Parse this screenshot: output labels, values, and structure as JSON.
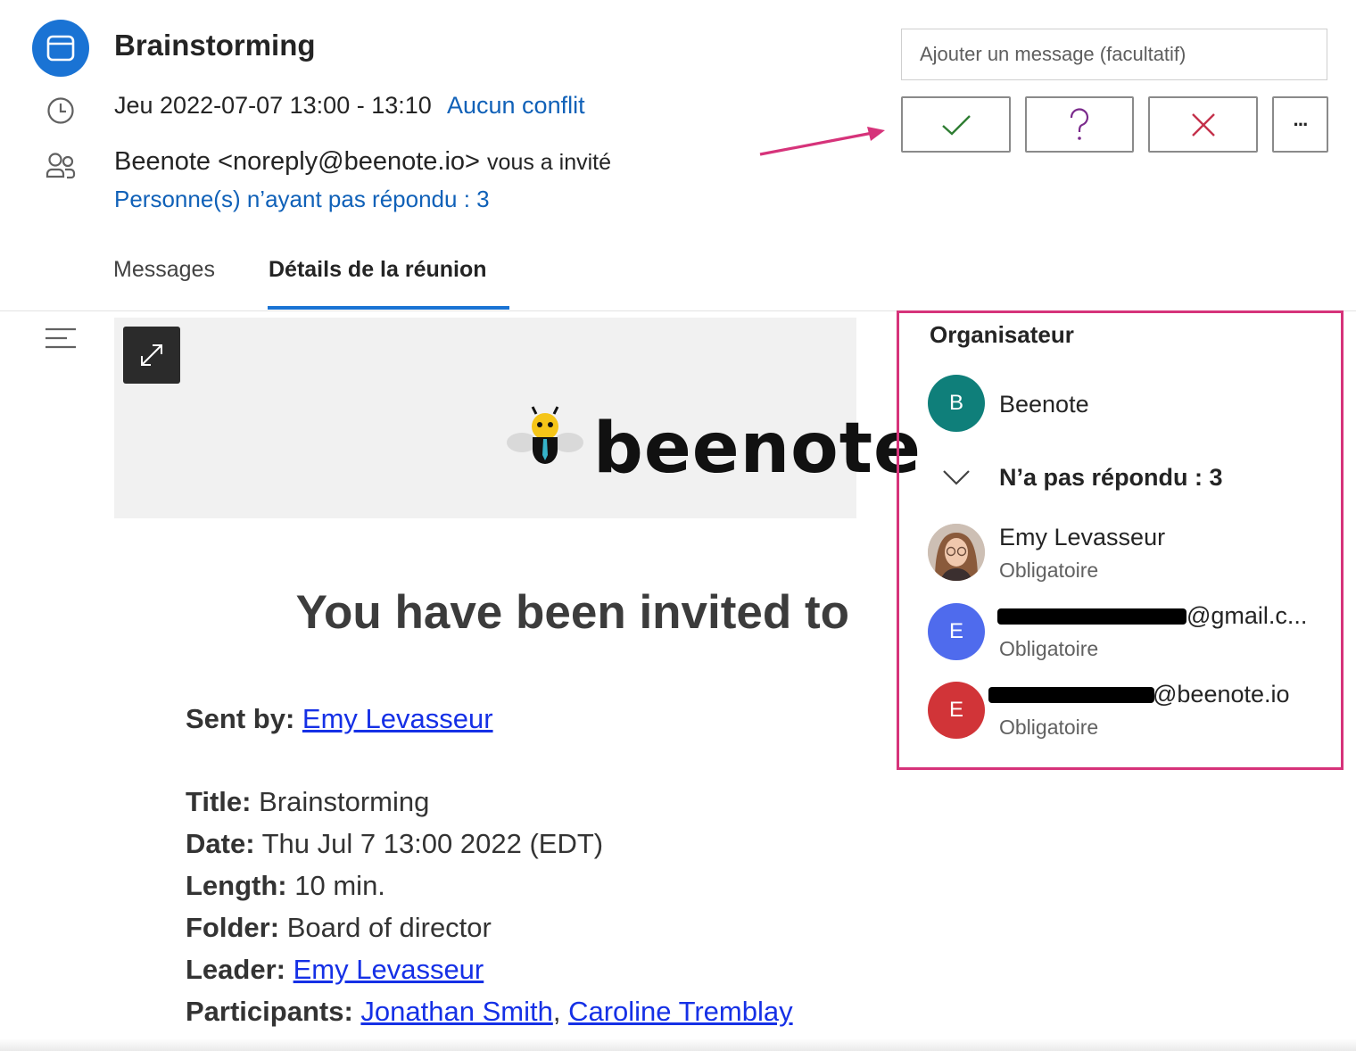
{
  "header": {
    "title": "Brainstorming",
    "date": "Jeu 2022-07-07 13:00 - 13:10",
    "conflict": "Aucun conflit",
    "organizer": "Beenote <noreply@beenote.io>",
    "invited": "vous a invité",
    "no_response": "Personne(s) n’ayant pas répondu : 3",
    "icons": [
      "calendar-icon",
      "clock-icon",
      "people-icon"
    ]
  },
  "response": {
    "message_placeholder": "Ajouter un message (facultatif)",
    "more_label": "···",
    "colors": {
      "accept": "#2e7d32",
      "tentative": "#7b2b8c",
      "decline": "#c4314b"
    }
  },
  "tabs": [
    {
      "label": "Messages"
    },
    {
      "label": "Détails de la réunion",
      "active": true
    }
  ],
  "content": {
    "logo_text": "beenote",
    "heading": "You have been invited to",
    "rows": [
      {
        "label": "Sent by:",
        "links": [
          "Emy Levasseur"
        ]
      },
      {
        "label": "Title:",
        "value": "Brainstorming"
      },
      {
        "label": "Date:",
        "value": "Thu Jul 7 13:00 2022 (EDT)"
      },
      {
        "label": "Length:",
        "value": "10 min."
      },
      {
        "label": "Folder:",
        "value": "Board of director"
      },
      {
        "label": "Leader:",
        "links": [
          "Emy Levasseur"
        ]
      },
      {
        "label": "Participants:",
        "links": [
          "Jonathan Smith",
          "Caroline Tremblay"
        ],
        "separator": ", "
      }
    ]
  },
  "attendees": {
    "organizer_heading": "Organisateur",
    "organizer": {
      "initial": "B",
      "name": "Beenote",
      "color": "#0f7f7a"
    },
    "no_response_heading": "N’a pas répondu : 3",
    "people": [
      {
        "name": "Emy Levasseur",
        "role": "Obligatoire"
      },
      {
        "initial": "E",
        "name_suffix": "@gmail.c...",
        "role": "Obligatoire",
        "color": "#4f6bed"
      },
      {
        "initial": "E",
        "name_suffix": "@beenote.io",
        "role": "Obligatoire",
        "color": "#d13438"
      }
    ]
  },
  "accent_color": "#d6337a"
}
